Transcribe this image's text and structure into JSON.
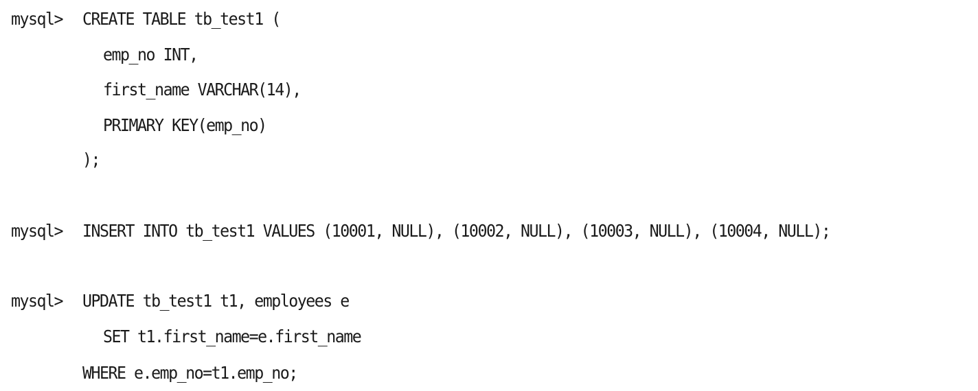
{
  "prompt": "mysql>",
  "statements": {
    "create_table": {
      "line1": "CREATE TABLE tb_test1 (",
      "line2": "emp_no INT,",
      "line3": "first_name VARCHAR(14),",
      "line4": "PRIMARY KEY(emp_no)",
      "line5": ");"
    },
    "insert": {
      "line1": "INSERT INTO tb_test1 VALUES (10001, NULL), (10002, NULL), (10003, NULL), (10004, NULL);"
    },
    "update": {
      "line1": "UPDATE tb_test1 t1, employees e",
      "line2": "SET t1.first_name=e.first_name",
      "line3": "WHERE e.emp_no=t1.emp_no;"
    }
  }
}
